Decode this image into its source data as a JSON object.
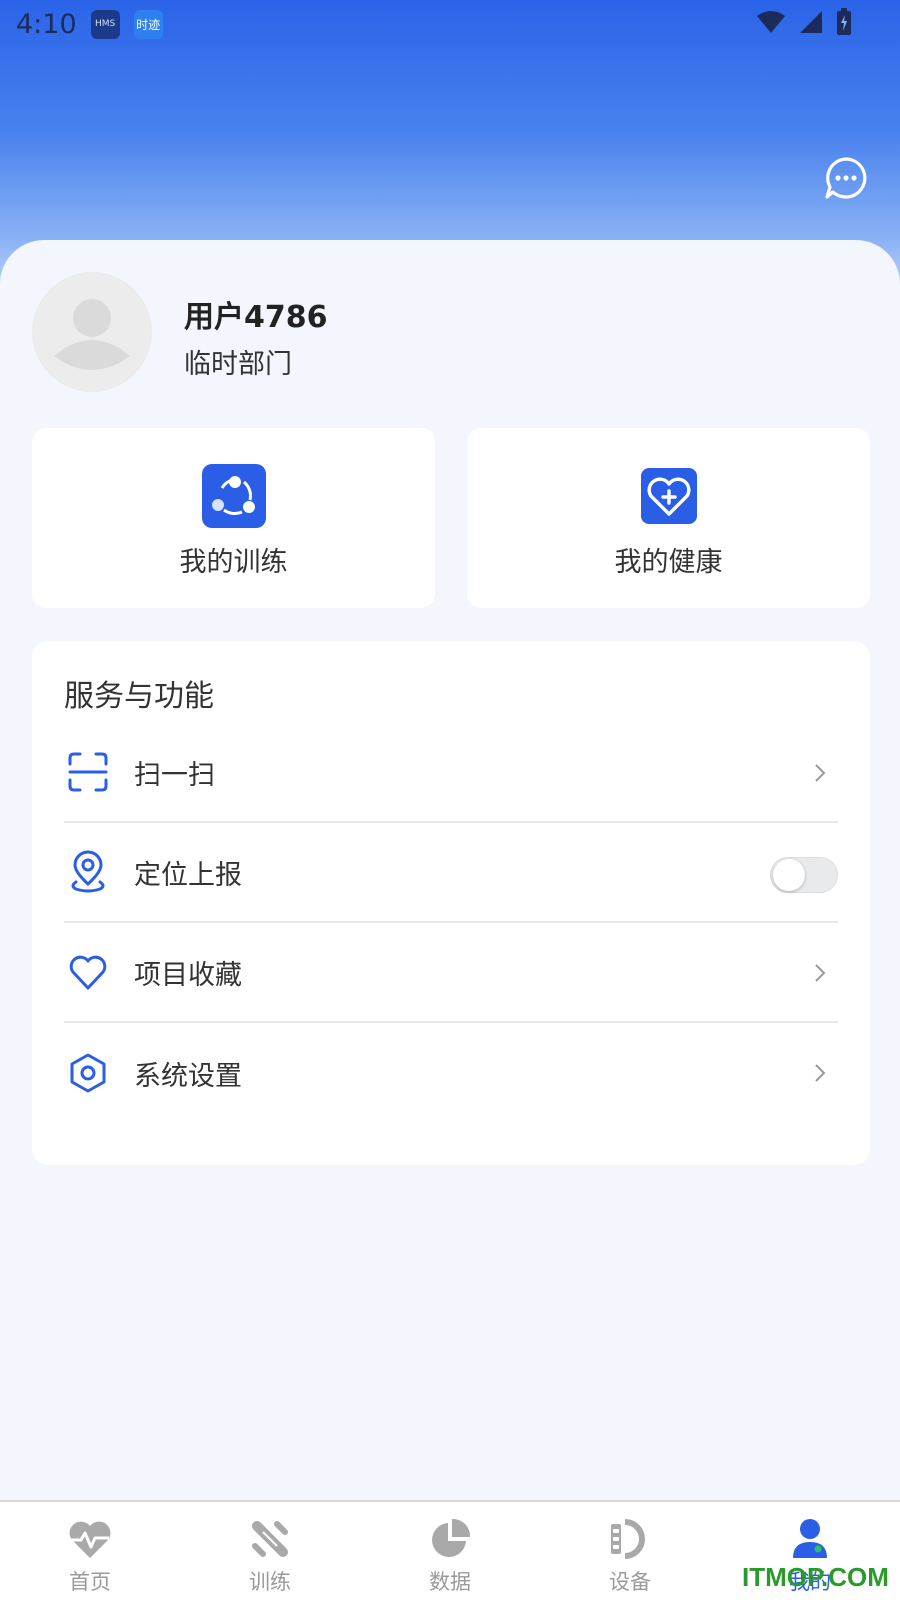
{
  "status_bar": {
    "time": "4:10",
    "badges": [
      "HMS",
      "时迹"
    ],
    "icons": [
      "wifi-icon",
      "signal-icon",
      "battery-charging-icon"
    ]
  },
  "header": {
    "message_icon": "chat-bubble-icon"
  },
  "user": {
    "name": "用户4786",
    "department": "临时部门",
    "avatar": "default-avatar-icon"
  },
  "quick_actions": [
    {
      "label": "我的训练",
      "icon": "share-nodes-icon"
    },
    {
      "label": "我的健康",
      "icon": "heart-plus-icon"
    }
  ],
  "services": {
    "title": "服务与功能",
    "items": [
      {
        "label": "扫一扫",
        "icon": "scan-icon",
        "control": "chevron"
      },
      {
        "label": "定位上报",
        "icon": "location-icon",
        "control": "toggle",
        "toggle_on": false
      },
      {
        "label": "项目收藏",
        "icon": "heart-outline-icon",
        "control": "chevron"
      },
      {
        "label": "系统设置",
        "icon": "hexagon-settings-icon",
        "control": "chevron"
      }
    ]
  },
  "tabs": [
    {
      "label": "首页",
      "icon": "heartbeat-icon",
      "active": false
    },
    {
      "label": "训练",
      "icon": "training-icon",
      "active": false
    },
    {
      "label": "数据",
      "icon": "pie-chart-icon",
      "active": false
    },
    {
      "label": "设备",
      "icon": "device-icon",
      "active": false
    },
    {
      "label": "我的",
      "icon": "user-icon",
      "active": true
    }
  ],
  "watermark": "ITMOP.COM",
  "colors": {
    "accent": "#2a5ee6",
    "hero_top": "#2a63e8",
    "tab_inactive": "#9a9a9a"
  }
}
